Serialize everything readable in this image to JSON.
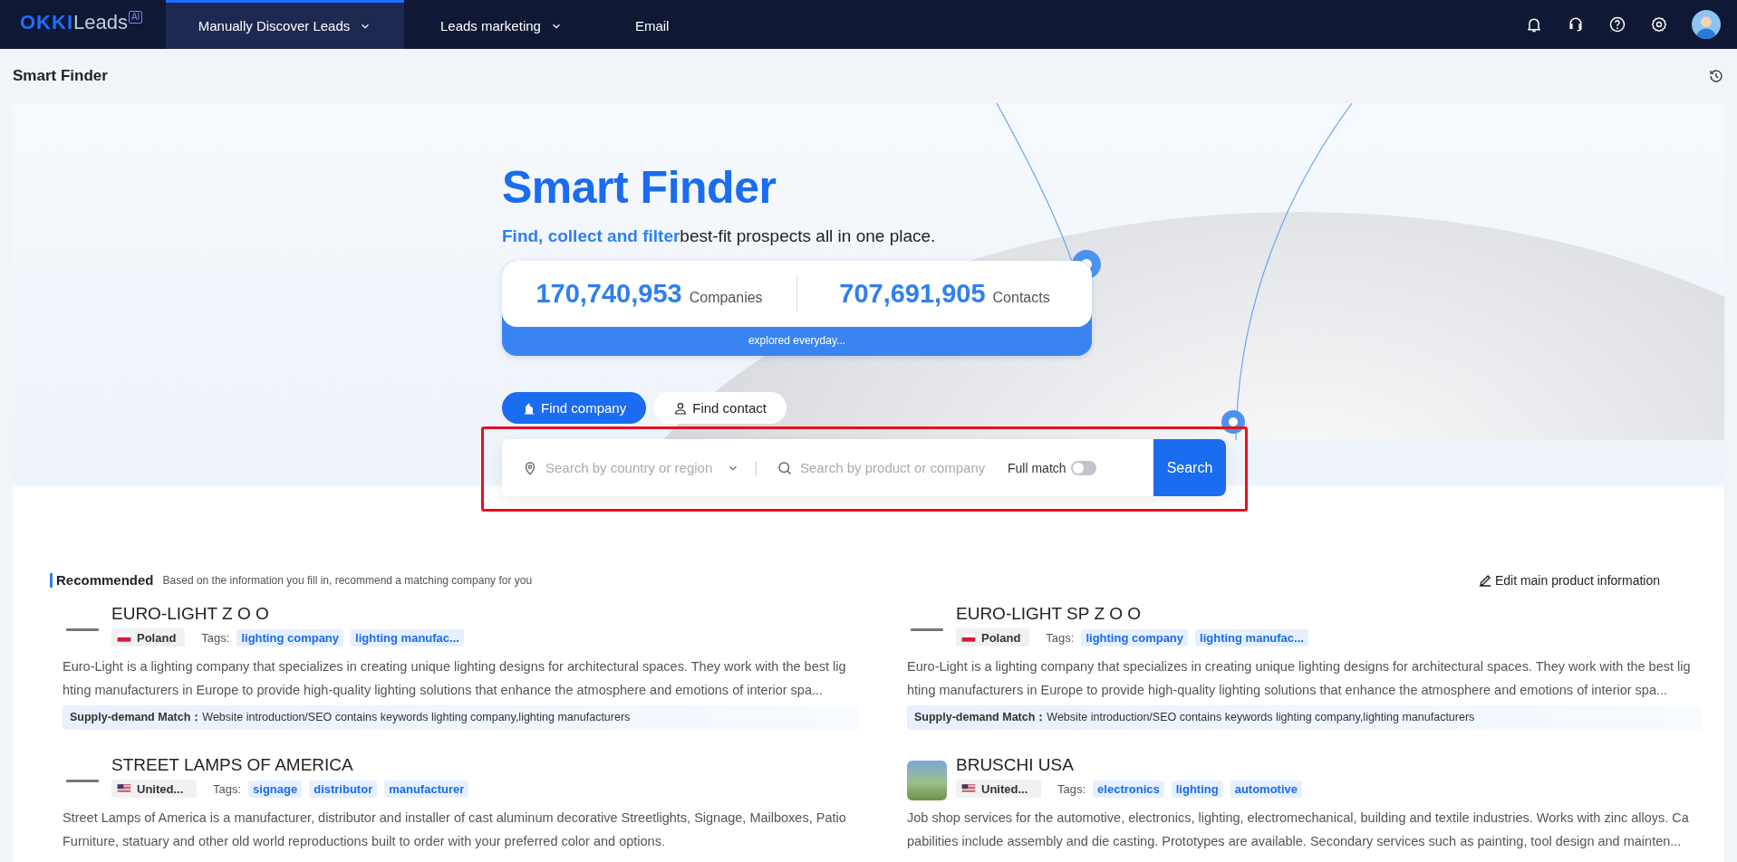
{
  "header": {
    "logo": {
      "brand": "OKKI",
      "product": "Leads",
      "badge": "AI"
    },
    "nav": [
      {
        "label": "Manually Discover Leads",
        "selected": true,
        "dropdown": true
      },
      {
        "label": "Leads marketing",
        "selected": false,
        "dropdown": true
      },
      {
        "label": "Email",
        "selected": false,
        "dropdown": false
      }
    ]
  },
  "page_title": "Smart Finder",
  "hero": {
    "title": "Smart Finder",
    "subtitle_highlight": "Find, collect and filter",
    "subtitle": "best-fit prospects all in one place.",
    "stats": [
      {
        "value": "170,740,953",
        "label": "Companies"
      },
      {
        "value": "707,691,905",
        "label": "Contacts"
      }
    ],
    "stats_footer": "explored everyday..."
  },
  "search": {
    "tabs": [
      {
        "label": "Find company",
        "selected": true,
        "kind": "company"
      },
      {
        "label": "Find contact",
        "selected": false,
        "kind": "contact"
      }
    ],
    "region_placeholder": "Search by country or region",
    "query_placeholder": "Search by product or company",
    "full_match": {
      "label": "Full match",
      "on": false
    },
    "button": "Search",
    "highlighted": true
  },
  "recommended": {
    "title": "Recommended",
    "subtitle": "Based on the information you fill in, recommend a matching company for you",
    "edit_link": "Edit main product information",
    "companies": [
      {
        "name": "EURO-LIGHT Z O O",
        "logo": {
          "kind": "wordmark"
        },
        "flag": {
          "kind": "pl"
        },
        "country": "Poland",
        "tags_label": "Tags:",
        "tags": [
          "lighting company",
          "lighting manufac..."
        ],
        "description": "Euro-Light is a lighting company that specializes in creating unique lighting designs for architectural spaces. They work with the best lighting manufacturers in Europe to provide high-quality lighting solutions that enhance the atmosphere and emotions of interior spa...",
        "match": {
          "label": "Supply-demand Match：",
          "text": "Website introduction/SEO contains keywords lighting company,lighting manufacturers"
        }
      },
      {
        "name": "EURO-LIGHT SP Z O O",
        "logo": {
          "kind": "wordmark"
        },
        "flag": {
          "kind": "pl"
        },
        "country": "Poland",
        "tags_label": "Tags:",
        "tags": [
          "lighting company",
          "lighting manufac..."
        ],
        "description": "Euro-Light is a lighting company that specializes in creating unique lighting designs for architectural spaces. They work with the best lighting manufacturers in Europe to provide high-quality lighting solutions that enhance the atmosphere and emotions of interior spa...",
        "match": {
          "label": "Supply-demand Match：",
          "text": "Website introduction/SEO contains keywords lighting company,lighting manufacturers"
        }
      },
      {
        "name": "STREET LAMPS OF AMERICA",
        "logo": {
          "kind": "wordmark"
        },
        "flag": {
          "kind": "us"
        },
        "country": "United...",
        "tags_label": "Tags:",
        "tags": [
          "signage",
          "distributor",
          "manufacturer"
        ],
        "description": "Street Lamps of America is a manufacturer, distributor and installer of cast aluminum decorative Streetlights, Signage, Mailboxes, Patio Furniture, statuary and other old world reproductions built to order with your preferred color and options."
      },
      {
        "name": "BRUSCHI USA",
        "logo": {
          "kind": "photo"
        },
        "flag": {
          "kind": "us"
        },
        "country": "United...",
        "tags_label": "Tags:",
        "tags": [
          "electronics",
          "lighting",
          "automotive"
        ],
        "description": "Job shop services for the automotive, electronics, lighting, electromechanical, building and textile industries. Works with zinc alloys. Capabilities include assembly and die casting. Prototypes are available. Secondary services such as painting, tool design and mainten..."
      }
    ]
  }
}
